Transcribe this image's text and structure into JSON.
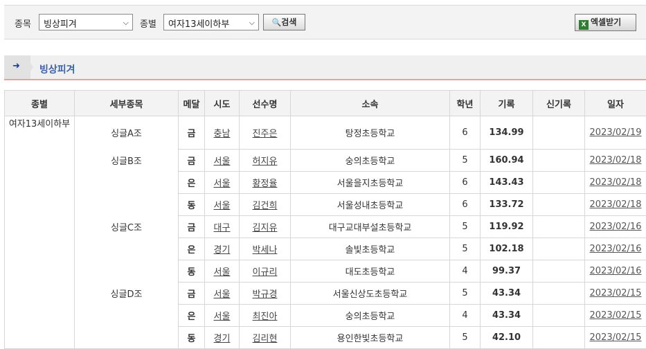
{
  "search": {
    "event_label": "종목",
    "event_value": "빙상피겨",
    "category_label": "종별",
    "category_value": "여자13세이하부",
    "search_button": "검색",
    "excel_button": "엑셀받기"
  },
  "section": {
    "title": "빙상피겨"
  },
  "table": {
    "headers": [
      "종별",
      "세부종목",
      "메달",
      "시도",
      "선수명",
      "소속",
      "학년",
      "기록",
      "신기록",
      "일자"
    ],
    "rows": [
      {
        "category": "여자13세이하부",
        "detail": "싱글A조",
        "medal": "금",
        "region": "충남",
        "name": "진주은",
        "school": "탕정초등학교",
        "grade": "6",
        "record": "134.99",
        "new_record": "",
        "date": "2023/02/19"
      },
      {
        "category": "",
        "detail": "싱글B조",
        "medal": "금",
        "region": "서울",
        "name": "허지유",
        "school": "숭의초등학교",
        "grade": "5",
        "record": "160.94",
        "new_record": "",
        "date": "2023/02/18"
      },
      {
        "category": "",
        "detail": "",
        "medal": "은",
        "region": "서울",
        "name": "황정율",
        "school": "서울을지초등학교",
        "grade": "6",
        "record": "143.43",
        "new_record": "",
        "date": "2023/02/18"
      },
      {
        "category": "",
        "detail": "",
        "medal": "동",
        "region": "서울",
        "name": "김건희",
        "school": "서울성내초등학교",
        "grade": "6",
        "record": "133.72",
        "new_record": "",
        "date": "2023/02/18"
      },
      {
        "category": "",
        "detail": "싱글C조",
        "medal": "금",
        "region": "대구",
        "name": "김지유",
        "school": "대구교대부설초등학교",
        "grade": "5",
        "record": "119.92",
        "new_record": "",
        "date": "2023/02/16"
      },
      {
        "category": "",
        "detail": "",
        "medal": "은",
        "region": "경기",
        "name": "박세나",
        "school": "솔빛초등학교",
        "grade": "5",
        "record": "102.18",
        "new_record": "",
        "date": "2023/02/16"
      },
      {
        "category": "",
        "detail": "",
        "medal": "동",
        "region": "서울",
        "name": "이규리",
        "school": "대도초등학교",
        "grade": "4",
        "record": "99.37",
        "new_record": "",
        "date": "2023/02/16"
      },
      {
        "category": "",
        "detail": "싱글D조",
        "medal": "금",
        "region": "서울",
        "name": "박규경",
        "school": "서울신상도초등학교",
        "grade": "5",
        "record": "43.34",
        "new_record": "",
        "date": "2023/02/15"
      },
      {
        "category": "",
        "detail": "",
        "medal": "은",
        "region": "서울",
        "name": "최진아",
        "school": "숭의초등학교",
        "grade": "4",
        "record": "43.34",
        "new_record": "",
        "date": "2023/02/15"
      },
      {
        "category": "",
        "detail": "",
        "medal": "동",
        "region": "경기",
        "name": "김리현",
        "school": "용인한빛초등학교",
        "grade": "5",
        "record": "42.10",
        "new_record": "",
        "date": "2023/02/15"
      }
    ]
  },
  "colors": {
    "medal": "#1a55a8",
    "record": "#e06a1d",
    "section_title": "#3a63a8",
    "accent_line": "#e9a0a0"
  }
}
